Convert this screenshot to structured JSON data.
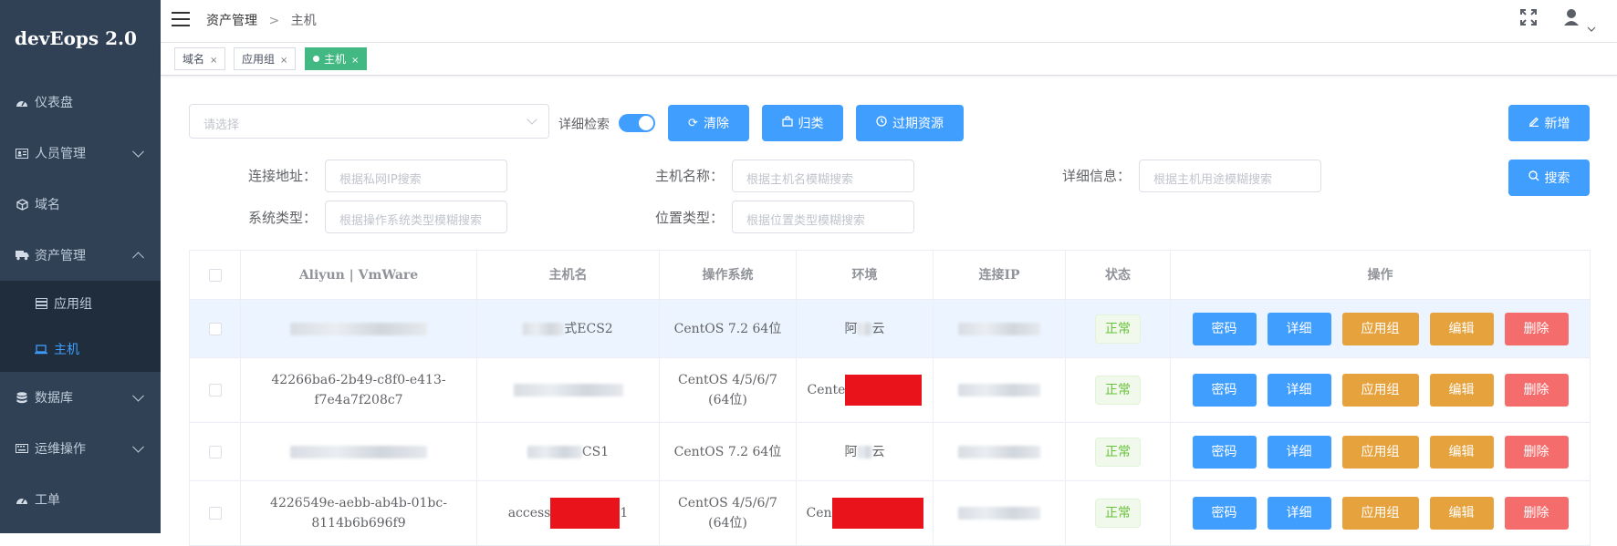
{
  "app": {
    "title": "devEops 2.0"
  },
  "sidebar": {
    "items": [
      {
        "label": "仪表盘",
        "icon": "dashboard-icon"
      },
      {
        "label": "人员管理",
        "icon": "id-card-icon"
      },
      {
        "label": "域名",
        "icon": "cube-icon"
      },
      {
        "label": "资产管理",
        "icon": "truck-icon"
      },
      {
        "label": "数据库",
        "icon": "database-icon"
      },
      {
        "label": "运维操作",
        "icon": "keyboard-icon"
      },
      {
        "label": "工单",
        "icon": "dashboard-icon"
      }
    ],
    "subitems": [
      {
        "label": "应用组",
        "icon": "server-icon"
      },
      {
        "label": "主机",
        "icon": "laptop-icon"
      }
    ]
  },
  "header": {
    "breadcrumb": [
      "资产管理",
      "主机"
    ],
    "separator": ">"
  },
  "tags": [
    {
      "label": "域名"
    },
    {
      "label": "应用组"
    },
    {
      "label": "主机"
    }
  ],
  "toolbar": {
    "select_placeholder": "请选择",
    "detail_search_label": "详细检索",
    "detail_search_enabled": true,
    "clear_label": "清除",
    "classify_label": "归类",
    "expired_label": "过期资源",
    "add_label": "新增",
    "search_label": "搜索"
  },
  "filters": {
    "address": {
      "label": "连接地址：",
      "placeholder": "根据私网IP搜索"
    },
    "hostname": {
      "label": "主机名称：",
      "placeholder": "根据主机名模糊搜索"
    },
    "detail": {
      "label": "详细信息：",
      "placeholder": "根据主机用途模糊搜索"
    },
    "os_type": {
      "label": "系统类型：",
      "placeholder": "根据操作系统类型模糊搜索"
    },
    "location": {
      "label": "位置类型：",
      "placeholder": "根据位置类型模糊搜索"
    }
  },
  "table": {
    "columns": [
      "Aliyun | VmWare",
      "主机名",
      "操作系统",
      "环境",
      "连接IP",
      "状态",
      "操作"
    ],
    "rows": [
      {
        "id": "",
        "hostname_suffix": "式ECS2",
        "os": "CentOS 7.2 64位",
        "env_prefix": "阿",
        "env_suffix": "云",
        "status": "正常"
      },
      {
        "id": "42266ba6-2b49-c8f0-e413-f7e4a7f208c7",
        "hostname_suffix": "",
        "os": "CentOS 4/5/6/7 (64位)",
        "env_prefix": "Cente",
        "env_suffix": "",
        "status": "正常"
      },
      {
        "id": "",
        "hostname_suffix": "CS1",
        "os": "CentOS 7.2 64位",
        "env_prefix": "阿",
        "env_suffix": "云",
        "status": "正常"
      },
      {
        "id": "4226549e-aebb-ab4b-01bc-8114b6b696f9",
        "hostname_prefix": "access",
        "hostname_suffix": "1",
        "os": "CentOS 4/5/6/7 (64位)",
        "env_prefix": "Cen",
        "env_suffix": "",
        "status": "正常"
      }
    ],
    "actions": {
      "password": "密码",
      "detail": "详细",
      "appgroup": "应用组",
      "edit": "编辑",
      "delete": "删除"
    }
  },
  "colors": {
    "sidebar_bg": "#304156",
    "primary": "#409eff",
    "warning": "#e6a23c",
    "danger": "#f56c6c",
    "success": "#67c23a",
    "tag_active": "#42b983"
  }
}
